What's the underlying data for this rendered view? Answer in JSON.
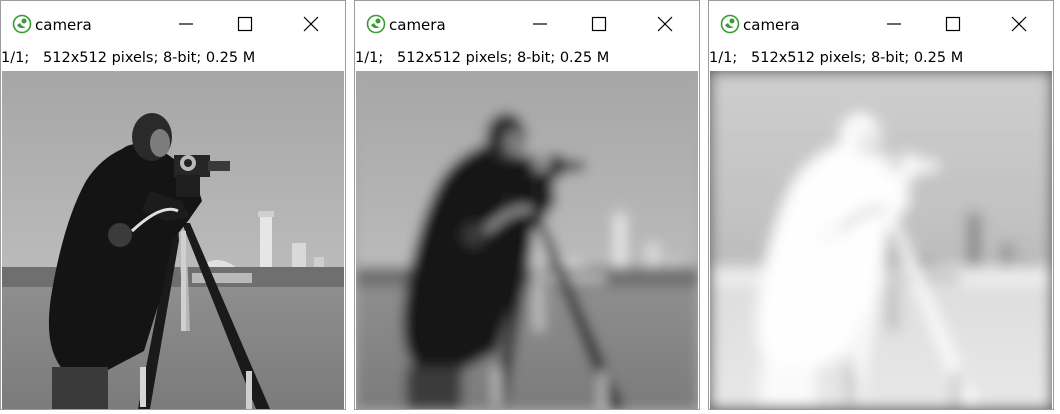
{
  "windows": [
    {
      "title": "camera",
      "info": "1/1;   512x512 pixels; 8-bit; 0.25 M",
      "image": {
        "icon": "cameraman-image",
        "variant": "original"
      }
    },
    {
      "title": "camera",
      "info": "1/1;   512x512 pixels; 8-bit; 0.25 M",
      "image": {
        "icon": "cameraman-image",
        "variant": "gaussian-blurred"
      }
    },
    {
      "title": "camera",
      "info": "1/1;   512x512 pixels; 8-bit; 0.25 M",
      "image": {
        "icon": "cameraman-image",
        "variant": "blurred-inverted"
      }
    }
  ],
  "controls": {
    "minimize": "minimize-icon",
    "maximize": "maximize-icon",
    "close": "close-icon"
  },
  "colors": {
    "icon_green": "#3a9b35",
    "border": "#9c9c9c"
  }
}
